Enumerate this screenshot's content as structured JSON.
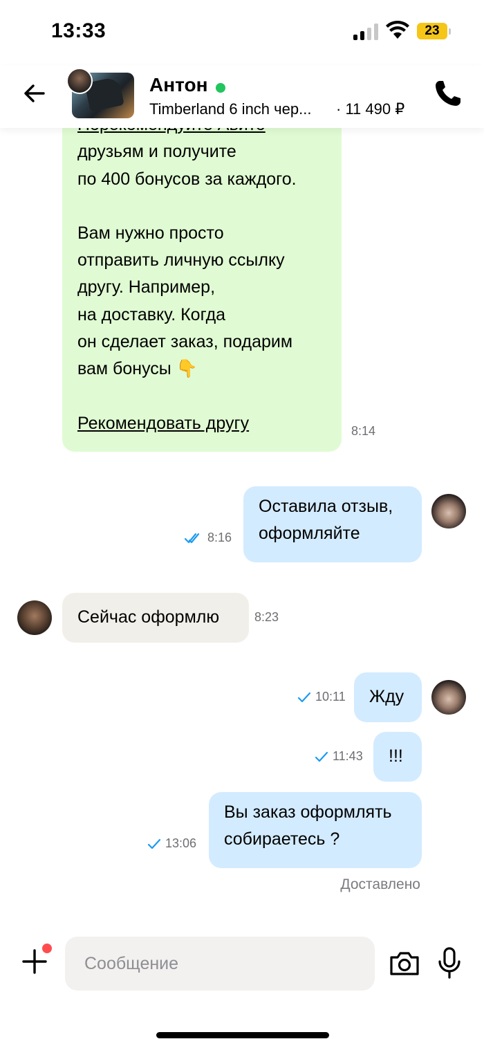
{
  "status_bar": {
    "time": "13:33",
    "battery": "23",
    "battery_color": "#f5c518"
  },
  "header": {
    "back_icon": "arrow-left-icon",
    "contact_name": "Антон",
    "online_color": "#22c55e",
    "listing_title": "Timberland 6 inch чер...",
    "listing_price": "· 11 490 ₽",
    "call_icon": "phone-icon"
  },
  "messages": {
    "promo": {
      "line1": "Порекомендуйте Авито",
      "line2": "друзьям и получите",
      "line3": "по 400 бонусов за каждого.",
      "line4": "Вам нужно просто",
      "line5": "отправить личную ссылку",
      "line6": "другу. Например,",
      "line7": "на доставку. Когда",
      "line8": "он сделает заказ, подарим",
      "line9": "вам бонусы 👇",
      "link": "Рекомендовать другу",
      "time": "8:14",
      "color": "#e0fbd3"
    },
    "m1": {
      "line1": "Оставила отзыв,",
      "line2": "оформляйте",
      "time": "8:16",
      "status": "read"
    },
    "m2": {
      "text": "Сейчас оформлю",
      "time": "8:23"
    },
    "m3": {
      "text": "Жду",
      "time": "10:11",
      "status": "sent"
    },
    "m4": {
      "text": "!!!",
      "time": "11:43",
      "status": "sent"
    },
    "m5": {
      "line1": "Вы заказ оформлять",
      "line2": "собираетесь ?",
      "time": "13:06",
      "status": "sent"
    },
    "delivered": "Доставлено",
    "outgoing_color": "#d3ebff",
    "incoming_color": "#f1efe9",
    "check_color": "#1a9bf0"
  },
  "input_bar": {
    "placeholder": "Сообщение",
    "plus_icon": "plus-icon",
    "camera_icon": "camera-icon",
    "mic_icon": "microphone-icon",
    "notification_dot_color": "#ff4d4f"
  }
}
